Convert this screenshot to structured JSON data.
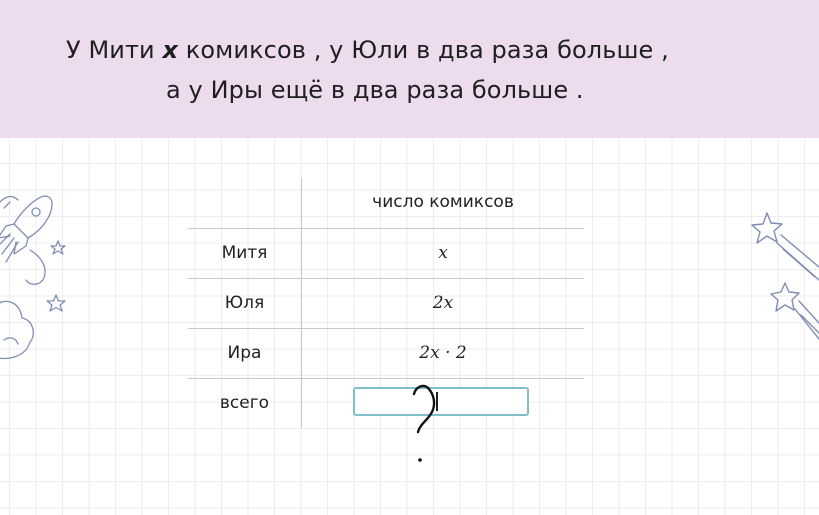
{
  "problem": {
    "line1_before": "У Мити ",
    "line1_var": "x",
    "line1_after": " комиксов ,  у Юли в два раза больше ,",
    "line2": "а у Иры ещё в два раза больше ."
  },
  "table": {
    "column_header": "число комиксов",
    "rows": [
      {
        "label": "Митя",
        "value": "x"
      },
      {
        "label": "Юля",
        "value": "2x"
      },
      {
        "label": "Ира",
        "value": "2x · 2"
      },
      {
        "label": "всего",
        "value": ""
      }
    ]
  },
  "answer_input": {
    "value": ""
  },
  "handwritten_mark": "?",
  "colors": {
    "header_bg": "#ecdcee",
    "input_border": "#7fbfc9",
    "decor": "#7f8db3"
  },
  "decor_icons": [
    "rocket-icon",
    "star-icon",
    "cloud-icon",
    "shooting-star-icon"
  ]
}
